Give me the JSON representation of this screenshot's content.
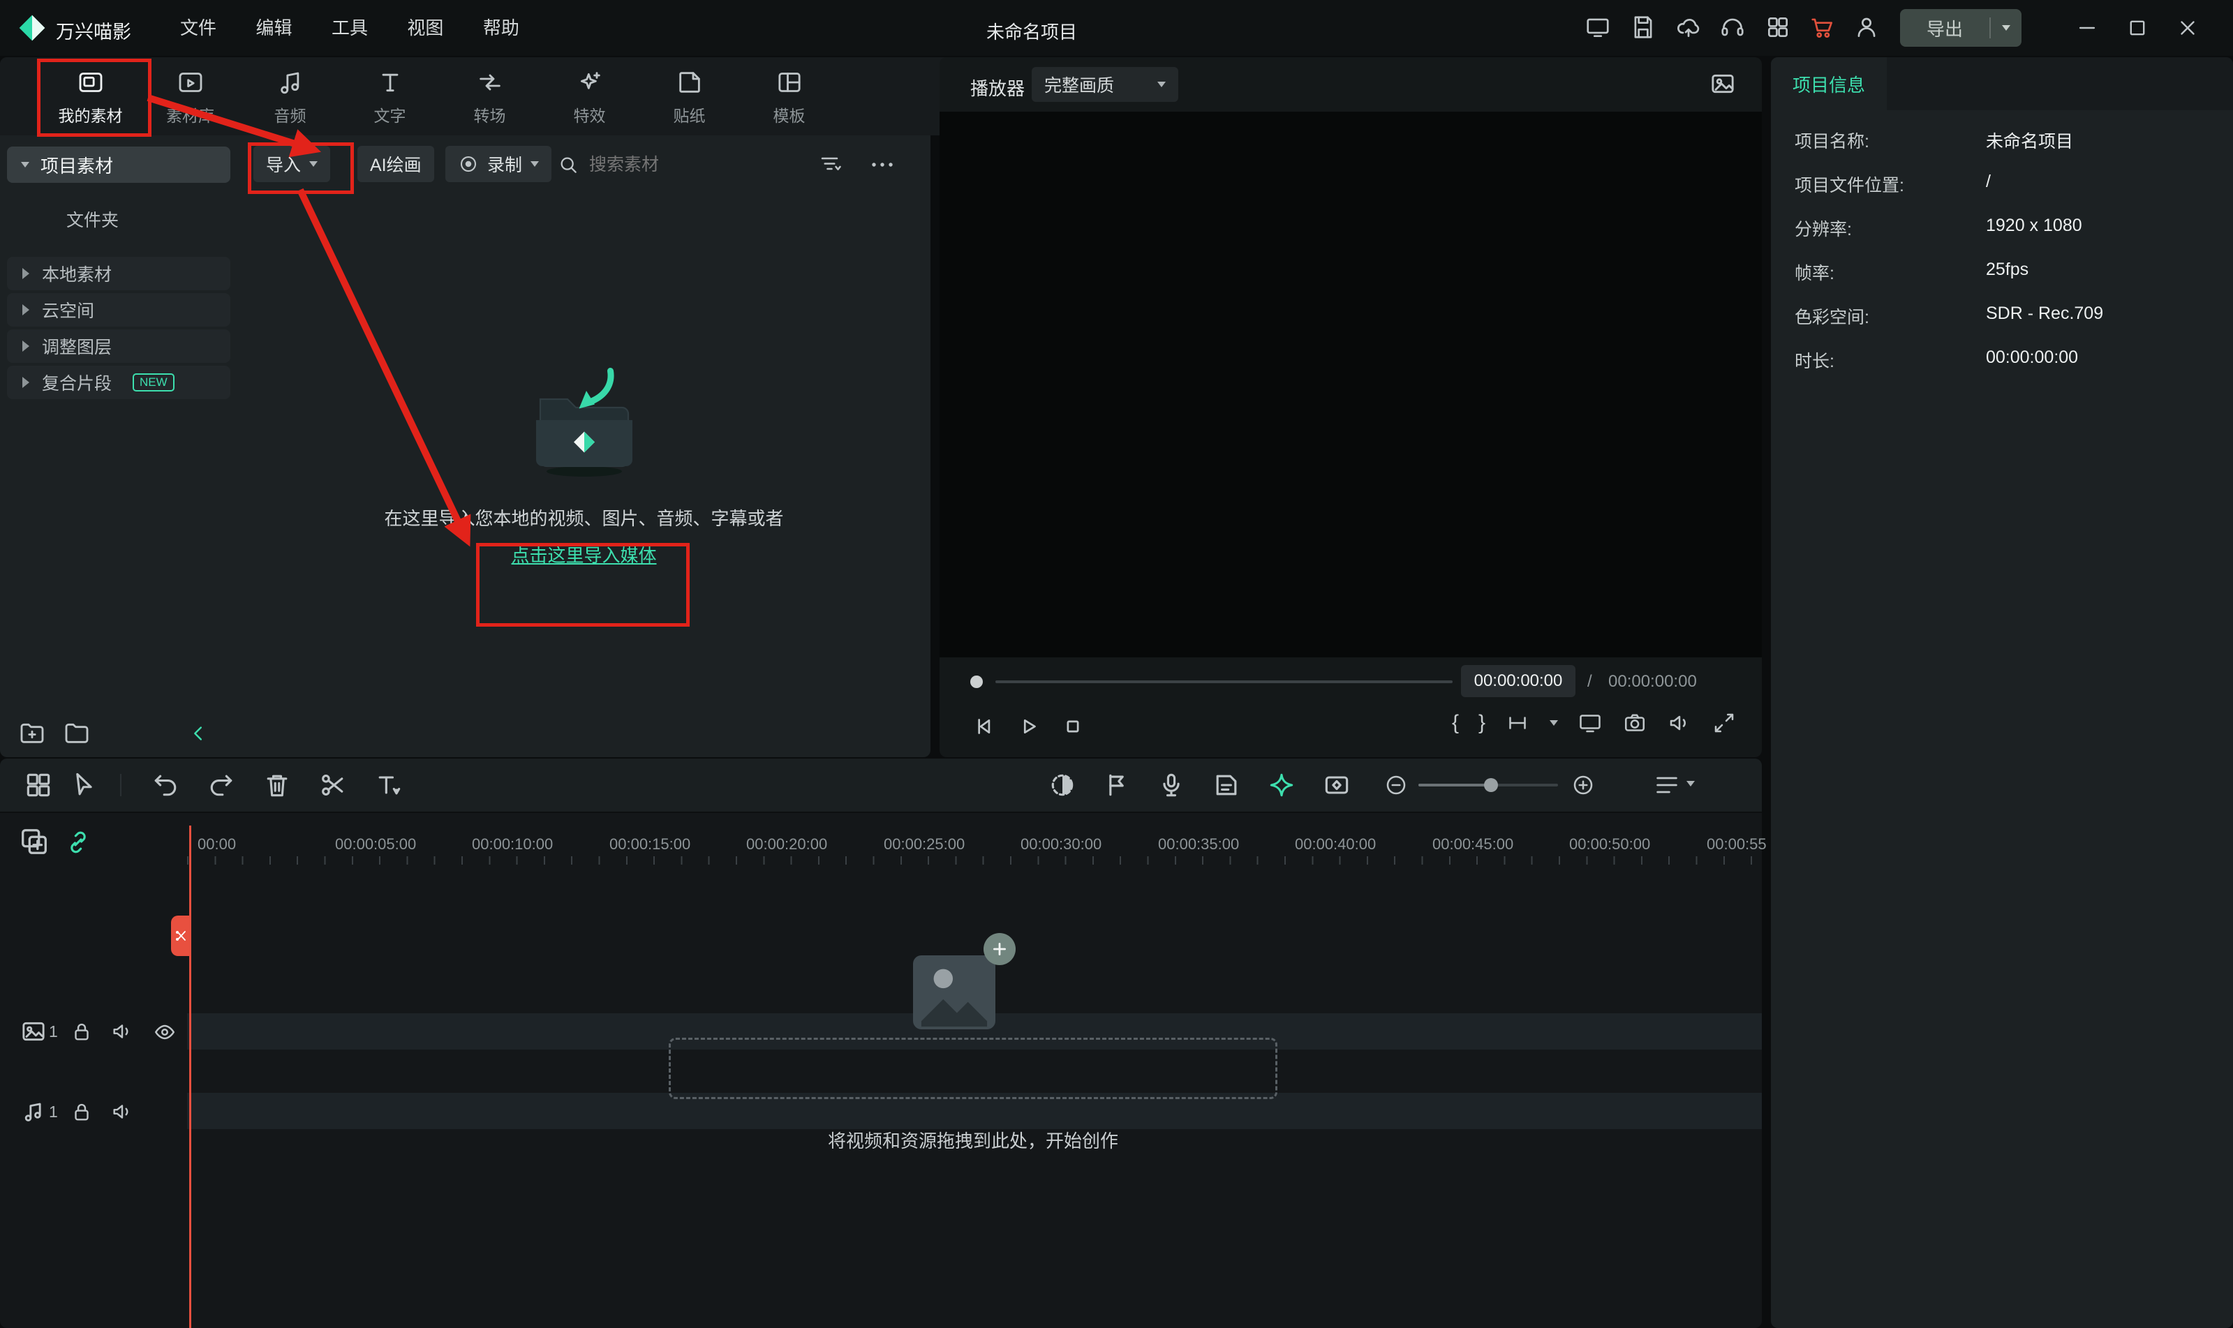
{
  "topbar": {
    "app_name": "万兴喵影",
    "menus": [
      {
        "label": "文件"
      },
      {
        "label": "编辑"
      },
      {
        "label": "工具"
      },
      {
        "label": "视图"
      },
      {
        "label": "帮助"
      }
    ],
    "project_title": "未命名项目",
    "export_label": "导出"
  },
  "media": {
    "tabs": [
      {
        "label": "我的素材"
      },
      {
        "label": "素材库"
      },
      {
        "label": "音频"
      },
      {
        "label": "文字"
      },
      {
        "label": "转场"
      },
      {
        "label": "特效"
      },
      {
        "label": "贴纸"
      },
      {
        "label": "模板"
      }
    ],
    "sidebar": {
      "project_item": "项目素材",
      "folder_item": "文件夹",
      "groups": [
        {
          "label": "本地素材"
        },
        {
          "label": "云空间"
        },
        {
          "label": "调整图层"
        },
        {
          "label": "复合片段",
          "badge": "NEW"
        }
      ]
    },
    "toolbar": {
      "import": "导入",
      "ai_paint": "AI绘画",
      "record": "录制",
      "search_placeholder": "搜索素材"
    },
    "empty": {
      "line1": "在这里导入您本地的视频、图片、音频、字幕或者",
      "link": "点击这里导入媒体"
    }
  },
  "preview": {
    "player": "播放器",
    "quality": "完整画质",
    "current_time": "00:00:00:00",
    "time_divider": "/",
    "total_time": "00:00:00:00",
    "brace_open": "{",
    "brace_close": "}"
  },
  "info": {
    "title": "项目信息",
    "rows": [
      {
        "label": "项目名称:",
        "value": "未命名项目"
      },
      {
        "label": "项目文件位置:",
        "value": "/"
      },
      {
        "label": "分辨率:",
        "value": "1920 x 1080"
      },
      {
        "label": "帧率:",
        "value": "25fps"
      },
      {
        "label": "色彩空间:",
        "value": "SDR - Rec.709"
      },
      {
        "label": "时长:",
        "value": "00:00:00:00"
      }
    ]
  },
  "timeline": {
    "ruler": [
      "00:00",
      "00:00:05:00",
      "00:00:10:00",
      "00:00:15:00",
      "00:00:20:00",
      "00:00:25:00",
      "00:00:30:00",
      "00:00:35:00",
      "00:00:40:00",
      "00:00:45:00",
      "00:00:50:00",
      "00:00:55"
    ],
    "video_track": "1",
    "audio_track": "1",
    "drop_hint": "将视频和资源拖拽到此处，开始创作"
  },
  "colors": {
    "accent": "#3ddfae",
    "annotation": "#e2231a"
  }
}
